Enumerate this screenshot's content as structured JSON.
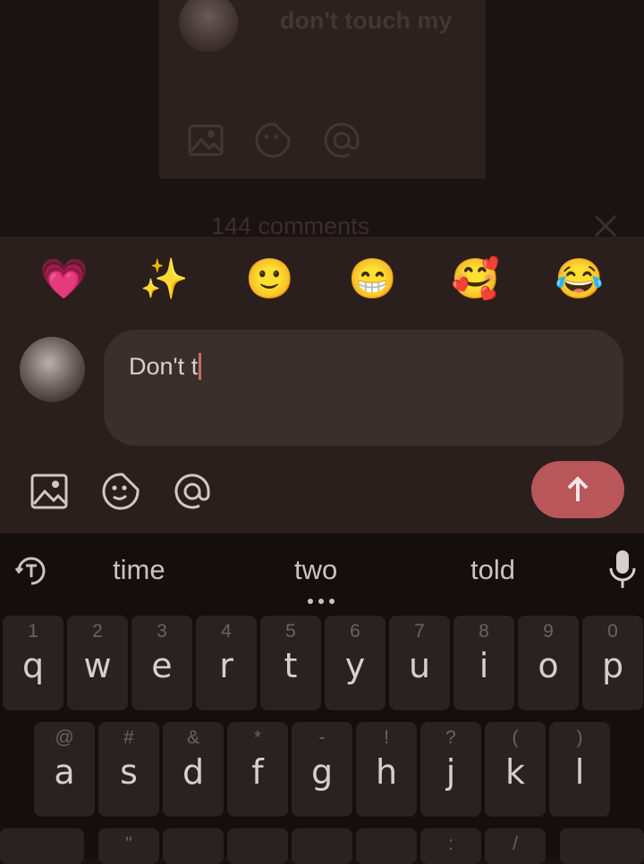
{
  "background": {
    "post_text": "don't touch my",
    "comments_count": "144 comments",
    "icons": [
      "image-icon",
      "sticker-icon",
      "mention-icon"
    ]
  },
  "reactions": [
    {
      "name": "heart-emoji",
      "glyph": "💗"
    },
    {
      "name": "sparkles-emoji",
      "glyph": "✨"
    },
    {
      "name": "smile-emoji",
      "glyph": "🙂"
    },
    {
      "name": "grin-emoji",
      "glyph": "😁"
    },
    {
      "name": "love-emoji",
      "glyph": "🥰"
    },
    {
      "name": "laugh-emoji",
      "glyph": "😂"
    }
  ],
  "composer": {
    "input_value": "Don't t",
    "tools": [
      "image-icon",
      "sticker-icon",
      "mention-icon"
    ],
    "send": "arrow-up-icon"
  },
  "keyboard": {
    "suggestions": [
      "time",
      "two",
      "told"
    ],
    "row1": [
      {
        "hint": "1",
        "key": "q"
      },
      {
        "hint": "2",
        "key": "w"
      },
      {
        "hint": "3",
        "key": "e"
      },
      {
        "hint": "4",
        "key": "r"
      },
      {
        "hint": "5",
        "key": "t"
      },
      {
        "hint": "6",
        "key": "y"
      },
      {
        "hint": "7",
        "key": "u"
      },
      {
        "hint": "8",
        "key": "i"
      },
      {
        "hint": "9",
        "key": "o"
      },
      {
        "hint": "0",
        "key": "p"
      }
    ],
    "row2": [
      {
        "hint": "@",
        "key": "a"
      },
      {
        "hint": "#",
        "key": "s"
      },
      {
        "hint": "&",
        "key": "d"
      },
      {
        "hint": "*",
        "key": "f"
      },
      {
        "hint": "-",
        "key": "g"
      },
      {
        "hint": "!",
        "key": "h"
      },
      {
        "hint": "?",
        "key": "j"
      },
      {
        "hint": "(",
        "key": "k"
      },
      {
        "hint": ")",
        "key": "l"
      }
    ],
    "row3_hints": [
      "\"",
      ":",
      "/"
    ]
  },
  "colors": {
    "send": "#b8565a",
    "sheet": "#2a1f1c",
    "keyboard": "#140e0d"
  }
}
